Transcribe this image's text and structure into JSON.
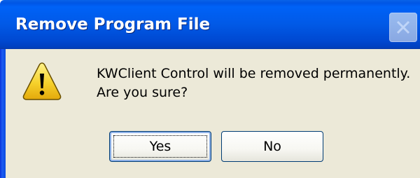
{
  "window": {
    "title": "Remove Program File"
  },
  "icons": {
    "title_close": "close-icon",
    "message": "warning-icon"
  },
  "dialog": {
    "message_line1": "KWClient Control will be removed permanently.",
    "message_line2": "Are you sure?"
  },
  "buttons": {
    "yes_label": "Yes",
    "no_label": "No"
  },
  "colors": {
    "titlebar": "#0058e6",
    "client_bg": "#ece9d8",
    "warning_fill": "#f6d12b"
  }
}
